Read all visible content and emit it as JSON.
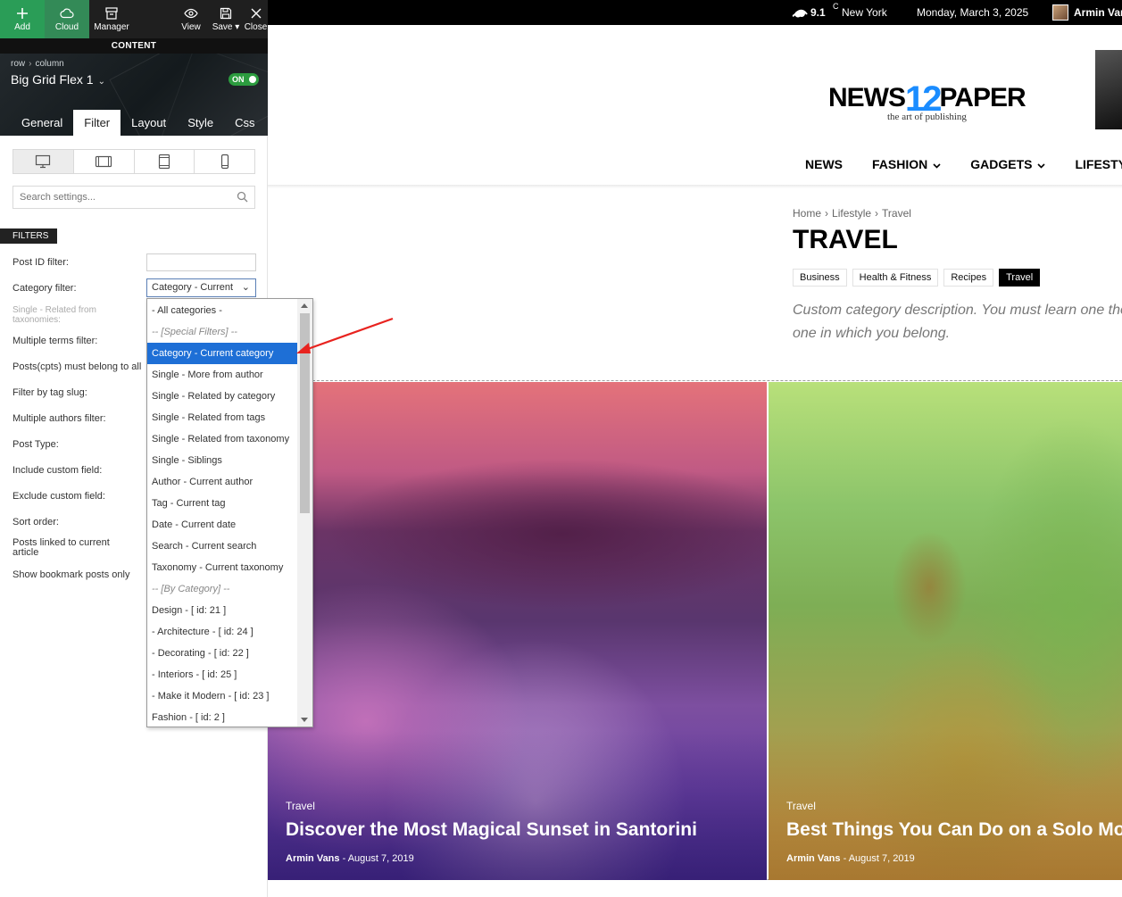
{
  "toolbar": {
    "add_label": "Add",
    "cloud_label": "Cloud",
    "manager_label": "Manager",
    "view_label": "View",
    "save_label": "Save",
    "close_label": "Close",
    "strip_label": "CONTENT"
  },
  "block": {
    "breadcrumb": [
      "row",
      "column"
    ],
    "title": "Big Grid Flex 1",
    "toggle_label": "ON",
    "tabs": [
      "General",
      "Filter",
      "Layout",
      "Style",
      "Css"
    ],
    "active_tab": "Filter"
  },
  "settings": {
    "search_placeholder": "Search settings...",
    "filters_label": "FILTERS",
    "rows": {
      "post_id": "Post ID filter:",
      "category": "Category filter:",
      "single_related": "Single - Related from taxonomies:",
      "multiple_terms": "Multiple terms filter:",
      "posts_must_belong": "Posts(cpts) must belong to all",
      "tag_slug": "Filter by tag slug:",
      "multiple_authors": "Multiple authors filter:",
      "post_type": "Post Type:",
      "include_field": "Include custom field:",
      "exclude_field": "Exclude custom field:",
      "sort_order": "Sort order:",
      "linked_posts": "Posts linked to current article",
      "bookmark": "Show bookmark posts only"
    },
    "category_select_value": "Category - Current"
  },
  "dropdown": {
    "items": [
      "- All categories -",
      "-- [Special Filters] --",
      "Category - Current category",
      "Single - More from author",
      "Single - Related by category",
      "Single - Related from tags",
      "Single - Related from taxonomy",
      "Single - Siblings",
      "Author - Current author",
      "Tag - Current tag",
      "Date - Current date",
      "Search - Current search",
      "Taxonomy - Current taxonomy",
      "-- [By Category] --",
      "Design - [ id: 21 ]",
      "- Architecture - [ id: 24 ]",
      "- Decorating - [ id: 22 ]",
      "- Interiors - [ id: 25 ]",
      "- Make it Modern - [ id: 23 ]",
      "Fashion - [ id: 2 ]"
    ],
    "selected_index": 2
  },
  "site": {
    "temp": "9.1",
    "unit": "C",
    "city": "New York",
    "date": "Monday, March 3, 2025",
    "user": "Armin Vans",
    "logo_left": "NEWS",
    "logo_num": "12",
    "logo_right": "PAPER",
    "tagline": "the art of publishing",
    "nav": [
      "NEWS",
      "FASHION",
      "GADGETS",
      "LIFESTYLE"
    ],
    "breadcrumb": [
      "Home",
      "Lifestyle",
      "Travel"
    ],
    "page_title": "TRAVEL",
    "pills": [
      "Business",
      "Health & Fitness",
      "Recipes",
      "Travel"
    ],
    "active_pill": "Travel",
    "description": "Custom category description. You must learn one the one in which you belong."
  },
  "articles": [
    {
      "category": "Travel",
      "title": "Discover the Most Magical Sunset in Santorini",
      "author": "Armin Vans",
      "date": "August 7, 2019"
    },
    {
      "category": "Travel",
      "title": "Best Things You Can Do on a Solo Mountain Trip",
      "author": "Armin Vans",
      "date": "August 7, 2019"
    }
  ],
  "colors": {
    "accent_green": "#2a9d57",
    "selection_blue": "#1e6fd6",
    "logo_blue": "#1a8cff",
    "arrow_red": "#e8231f"
  }
}
